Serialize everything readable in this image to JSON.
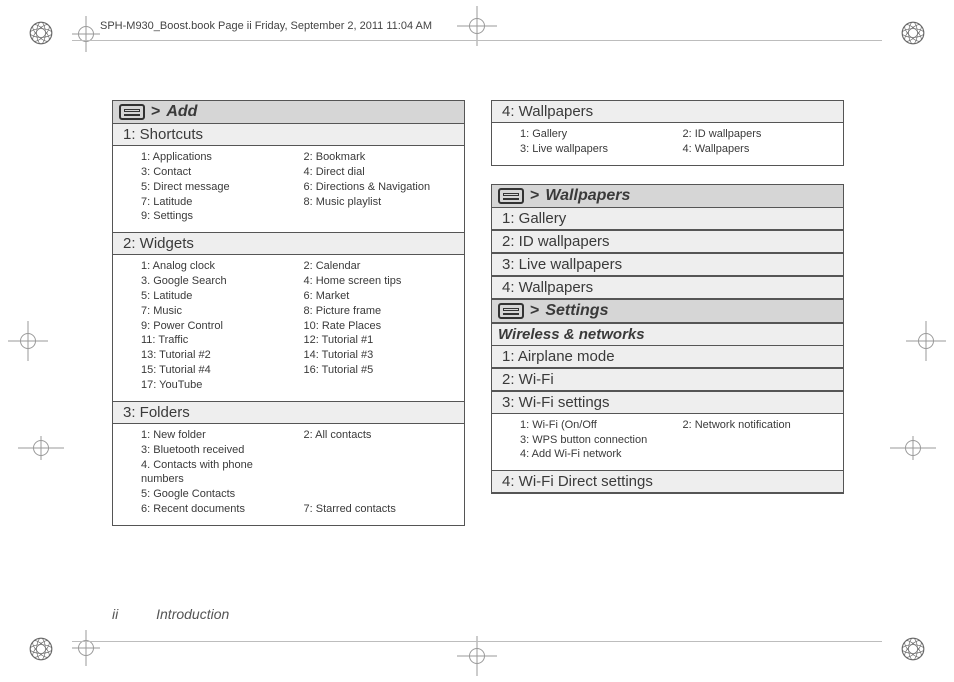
{
  "running_head": "SPH-M930_Boost.book  Page ii  Friday, September 2, 2011  11:04 AM",
  "footer": {
    "page": "ii",
    "section": "Introduction"
  },
  "left": {
    "heading": "Add",
    "sections": [
      {
        "title": "1: Shortcuts",
        "items": [
          "1: Applications",
          "2: Bookmark",
          "3: Contact",
          "4: Direct dial",
          "5: Direct message",
          "6: Directions & Navigation",
          "7: Latitude",
          "8: Music playlist",
          "9: Settings",
          ""
        ]
      },
      {
        "title": "2: Widgets",
        "items": [
          " 1:  Analog clock",
          " 2:  Calendar",
          " 3.  Google Search",
          " 4:  Home screen tips",
          " 5:  Latitude",
          " 6:  Market",
          " 7:  Music",
          " 8:  Picture frame",
          " 9:  Power Control",
          "10:  Rate Places",
          "11: Traffic",
          "12:  Tutorial #1",
          "13: Tutorial #2",
          "14: Tutorial #3",
          "15: Tutorial #4",
          "16: Tutorial #5",
          "17:  YouTube",
          ""
        ]
      },
      {
        "title": "3: Folders",
        "items": [
          "1: New folder",
          "2: All contacts",
          "3: Bluetooth received",
          "",
          "4. Contacts with phone numbers",
          "",
          "5: Google Contacts",
          "",
          "6: Recent documents",
          "7: Starred contacts"
        ]
      }
    ]
  },
  "right_top": {
    "section_title": "4: Wallpapers",
    "items": [
      "1: Gallery",
      "2: ID wallpapers",
      "3: Live wallpapers",
      "4: Wallpapers"
    ]
  },
  "right_wallpapers": {
    "heading": "Wallpapers",
    "rows": [
      "1: Gallery",
      "2: ID wallpapers",
      "3: Live wallpapers",
      "4: Wallpapers"
    ]
  },
  "right_settings": {
    "heading": "Settings",
    "category": "Wireless & networks",
    "rows_before": [
      "1: Airplane mode",
      "2: Wi-Fi",
      "3: Wi-Fi settings"
    ],
    "wifi_items": [
      "1: Wi-Fi   (On/Off",
      "2: Network notification",
      "3: WPS button connection",
      "",
      "4: Add Wi-Fi network",
      ""
    ],
    "rows_after": [
      "4: Wi-Fi Direct settings"
    ]
  }
}
